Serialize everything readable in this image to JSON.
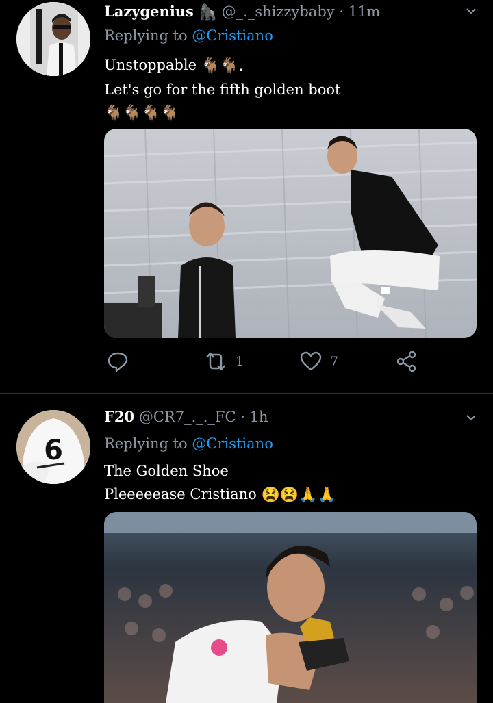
{
  "tweets": [
    {
      "name": "Lazygenius",
      "name_emoji": "🦍",
      "handle": "@_._shizzybaby",
      "separator": "·",
      "time": "11m",
      "replying_prefix": "Replying to",
      "replying_to": "@Cristiano",
      "line1": "Unstoppable",
      "line1_emojis": "🐐🐐.",
      "line2": "Let's go for the fifth golden boot",
      "line3_emojis": "🐐🐐🐐🐐",
      "retweet_count": "1",
      "like_count": "7"
    },
    {
      "name": "F20",
      "handle": "@CR7_._._FC",
      "separator": "·",
      "time": "1h",
      "replying_prefix": "Replying to",
      "replying_to": "@Cristiano",
      "line1": "The Golden Shoe",
      "line2": "Pleeeeease Cristiano",
      "line2_emojis": "😫😫🙏🙏",
      "avatar_number": "6"
    }
  ],
  "colors": {
    "background": "#000000",
    "muted": "#8b98a5",
    "link": "#1d9bf0",
    "divider": "#2f3336"
  },
  "icons": [
    "chevron-down-icon",
    "reply-icon",
    "retweet-icon",
    "like-icon",
    "share-icon"
  ]
}
